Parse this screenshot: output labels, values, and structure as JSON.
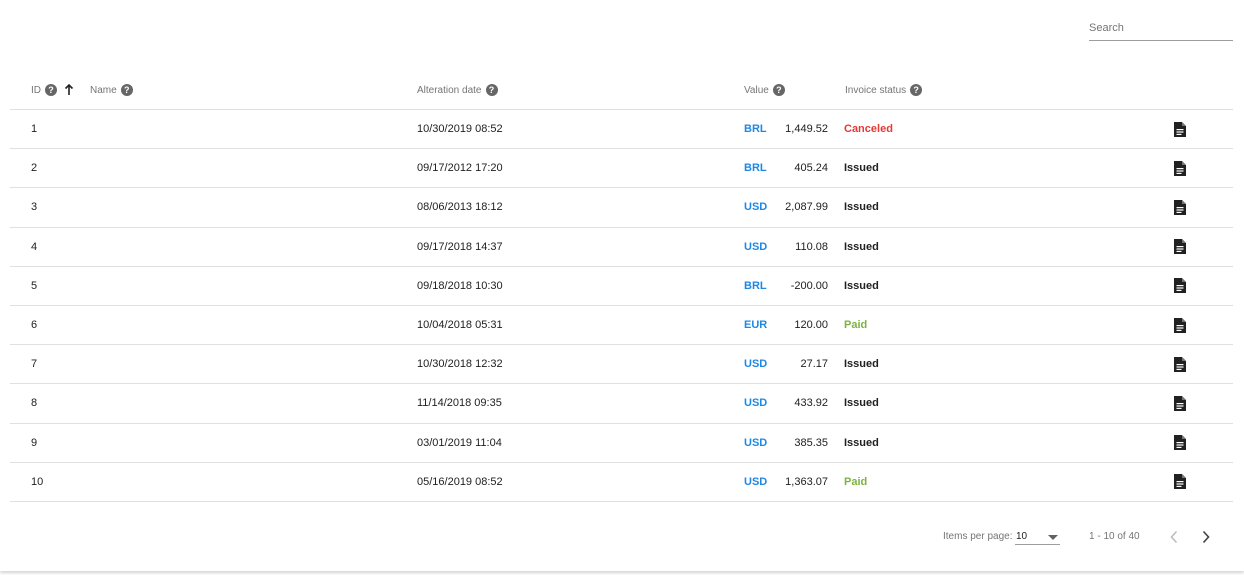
{
  "search": {
    "placeholder": "Search"
  },
  "colors": {
    "currency": "#1e88e5",
    "canceled": "#e53935",
    "paid": "#7cb342",
    "issued": "#212121"
  },
  "table": {
    "columns": {
      "id": "ID",
      "name": "Name",
      "date": "Alteration date",
      "value": "Value",
      "status": "Invoice status"
    },
    "help_glyph": "?",
    "sort_icon": "arrow-up-icon",
    "rows": [
      {
        "id": "1",
        "date": "10/30/2019 08:52",
        "currency": "BRL",
        "value": "1,449.52",
        "status": "Canceled",
        "status_key": "canceled"
      },
      {
        "id": "2",
        "date": "09/17/2012 17:20",
        "currency": "BRL",
        "value": "405.24",
        "status": "Issued",
        "status_key": "issued"
      },
      {
        "id": "3",
        "date": "08/06/2013 18:12",
        "currency": "USD",
        "value": "2,087.99",
        "status": "Issued",
        "status_key": "issued"
      },
      {
        "id": "4",
        "date": "09/17/2018 14:37",
        "currency": "USD",
        "value": "110.08",
        "status": "Issued",
        "status_key": "issued"
      },
      {
        "id": "5",
        "date": "09/18/2018 10:30",
        "currency": "BRL",
        "value": "-200.00",
        "status": "Issued",
        "status_key": "issued"
      },
      {
        "id": "6",
        "date": "10/04/2018 05:31",
        "currency": "EUR",
        "value": "120.00",
        "status": "Paid",
        "status_key": "paid"
      },
      {
        "id": "7",
        "date": "10/30/2018 12:32",
        "currency": "USD",
        "value": "27.17",
        "status": "Issued",
        "status_key": "issued"
      },
      {
        "id": "8",
        "date": "11/14/2018 09:35",
        "currency": "USD",
        "value": "433.92",
        "status": "Issued",
        "status_key": "issued"
      },
      {
        "id": "9",
        "date": "03/01/2019 11:04",
        "currency": "USD",
        "value": "385.35",
        "status": "Issued",
        "status_key": "issued"
      },
      {
        "id": "10",
        "date": "05/16/2019 08:52",
        "currency": "USD",
        "value": "1,363.07",
        "status": "Paid",
        "status_key": "paid"
      }
    ]
  },
  "paginator": {
    "items_per_page_label": "Items per page:",
    "items_per_page_value": "10",
    "range_label": "1 - 10 of 40"
  }
}
